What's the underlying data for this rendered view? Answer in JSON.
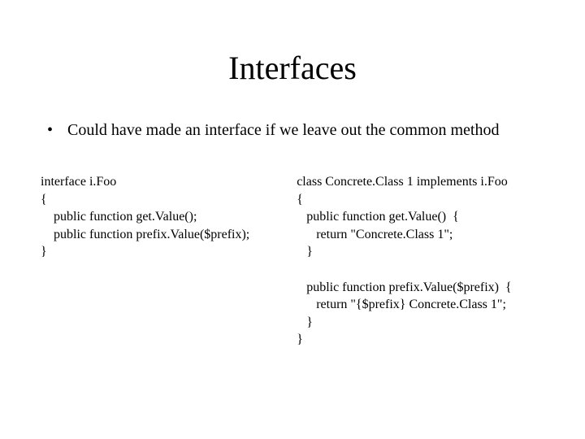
{
  "title": "Interfaces",
  "bullet": {
    "marker": "•",
    "text": "Could have made an interface if we leave out the common method"
  },
  "code": {
    "left": {
      "l1": "interface i.Foo",
      "l2": "{",
      "l3": "    public function get.Value();",
      "l4": "    public function prefix.Value($prefix);",
      "l5": "}"
    },
    "right": {
      "l1": "class Concrete.Class 1 implements i.Foo",
      "l2": "{",
      "l3": "   public function get.Value()  {",
      "l4": "      return \"Concrete.Class 1\";",
      "l5": "   }",
      "l6": "",
      "l7": "   public function prefix.Value($prefix)  {",
      "l8": "      return \"{$prefix} Concrete.Class 1\";",
      "l9": "   }",
      "l10": "}"
    }
  }
}
